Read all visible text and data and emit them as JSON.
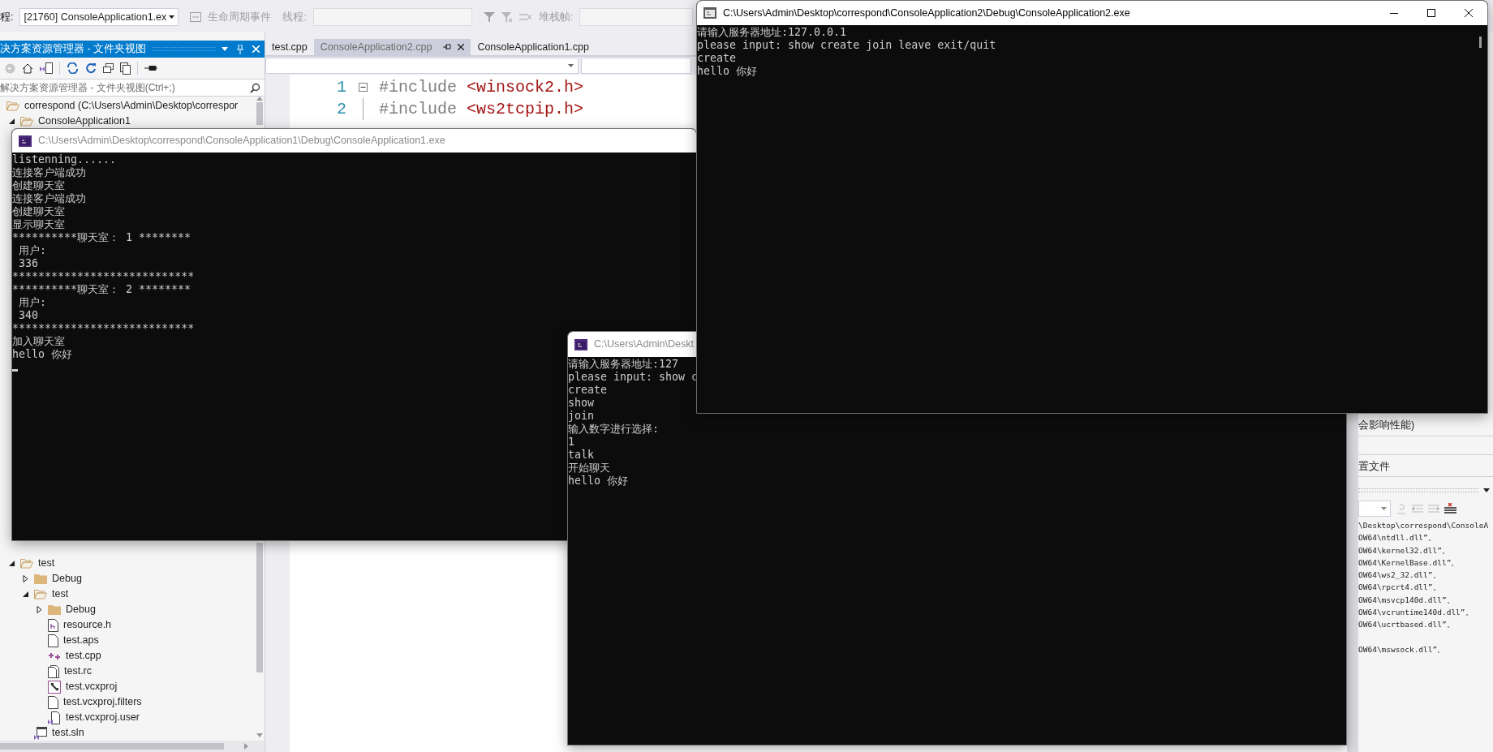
{
  "toolbar": {
    "process_label": "程:",
    "process_value": "[21760] ConsoleApplication1.ex",
    "lifecycle": "生命周期事件",
    "thread_label": "线程:",
    "stack_label": "堆栈帧:"
  },
  "solution_explorer": {
    "title": "决方案资源管理器 - 文件夹视图",
    "search_placeholder": "解决方案资源管理器 - 文件夹视图(Ctrl+;)",
    "tree": [
      {
        "label": "correspond (C:\\Users\\Admin\\Desktop\\correspor",
        "kind": "folder",
        "expanded": true,
        "children": [
          {
            "label": "ConsoleApplication1",
            "kind": "folder",
            "expanded": true
          },
          {
            "label": "test",
            "kind": "folder",
            "expanded": true,
            "children": [
              {
                "label": "Debug",
                "kind": "folder",
                "expanded": false
              },
              {
                "label": "test",
                "kind": "folder",
                "expanded": true,
                "children": [
                  {
                    "label": "Debug",
                    "kind": "folder",
                    "expanded": false
                  },
                  {
                    "label": "resource.h",
                    "kind": "header"
                  },
                  {
                    "label": "test.aps",
                    "kind": "file"
                  },
                  {
                    "label": "test.cpp",
                    "kind": "cpp"
                  },
                  {
                    "label": "test.rc",
                    "kind": "resource"
                  },
                  {
                    "label": "test.vcxproj",
                    "kind": "project"
                  },
                  {
                    "label": "test.vcxproj.filters",
                    "kind": "file"
                  },
                  {
                    "label": "test.vcxproj.user",
                    "kind": "user"
                  }
                ]
              },
              {
                "label": "test.sln",
                "kind": "solution"
              }
            ]
          }
        ]
      }
    ]
  },
  "editor": {
    "tabs": [
      {
        "label": "test.cpp",
        "selected": false
      },
      {
        "label": "ConsoleApplication2.cpp",
        "selected": true
      },
      {
        "label": "ConsoleApplication1.cpp",
        "selected": false
      }
    ],
    "lines": [
      {
        "number": "1",
        "directive": "#include",
        "header": "<winsock2.h>",
        "collapsible": true
      },
      {
        "number": "2",
        "directive": "#include",
        "header": "<ws2tcpip.h>",
        "collapsible": false
      }
    ]
  },
  "output_panel": {
    "note": "会影响性能)",
    "config": "置文件",
    "lines": [
      {
        "text": "\\Desktop\\correspond\\ConsoleA",
        "spaced": false
      },
      {
        "text": "OW64\\ntdll.dll”。",
        "spaced": false
      },
      {
        "text": "OW64\\kernel32.dll”。",
        "spaced": false
      },
      {
        "text": "OW64\\KernelBase.dll”。",
        "spaced": false
      },
      {
        "text": "OW64\\ws2_32.dll”。",
        "spaced": false
      },
      {
        "text": "OW64\\rpcrt4.dll”。",
        "spaced": false
      },
      {
        "text": "OW64\\msvcp140d.dll”。",
        "spaced": false
      },
      {
        "text": "OW64\\vcruntime140d.dll”。",
        "spaced": false
      },
      {
        "text": "OW64\\ucrtbased.dll”。",
        "spaced": false
      },
      {
        "text": "OW64\\mswsock.dll”。",
        "spaced": true
      }
    ]
  },
  "consoles": [
    {
      "title": "C:\\Users\\Admin\\Desktop\\correspond\\ConsoleApplication1\\Debug\\ConsoleApplication1.exe",
      "active": false,
      "cursor": true,
      "lines": [
        "listenning......",
        "连接客户端成功",
        "创建聊天室",
        "连接客户端成功",
        "创建聊天室",
        "显示聊天室",
        "**********聊天室： 1 ********",
        " 用户:",
        " 336",
        "****************************",
        "**********聊天室： 2 ********",
        " 用户:",
        " 340",
        "****************************",
        "加入聊天室",
        "hello 你好"
      ]
    },
    {
      "title": "C:\\Users\\Admin\\Desktop\\correspond\\ConsoleApplication2\\Debug\\ConsoleApplication2.exe",
      "active": true,
      "cursor": false,
      "lines": [
        "请输入服务器地址:127.0.0.1",
        "please input: show create join leave exit/quit",
        "create",
        "hello 你好"
      ]
    },
    {
      "title": "C:\\Users\\Admin\\Deskt",
      "active": false,
      "cursor": false,
      "lines": [
        "请输入服务器地址:127",
        "please input: show c",
        "create",
        "show",
        "join",
        "输入数字进行选择:",
        "1",
        "talk",
        "开始聊天",
        "hello 你好"
      ]
    }
  ]
}
